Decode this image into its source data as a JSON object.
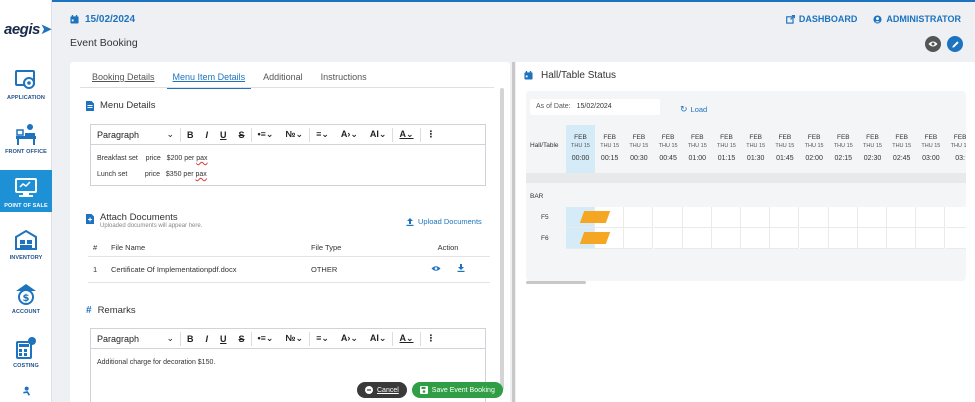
{
  "sidebar": {
    "logo": "aegis",
    "items": [
      {
        "label": "APPLICATION",
        "icon": "application-gear-icon",
        "active": false
      },
      {
        "label": "FRONT OFFICE",
        "icon": "front-office-icon",
        "active": false
      },
      {
        "label": "POINT OF SALE",
        "icon": "point-of-sale-icon",
        "active": true
      },
      {
        "label": "INVENTORY",
        "icon": "inventory-icon",
        "active": false
      },
      {
        "label": "ACCOUNT",
        "icon": "account-dollar-icon",
        "active": false
      },
      {
        "label": "COSTING",
        "icon": "costing-calculator-icon",
        "active": false
      }
    ]
  },
  "header": {
    "date": "15/02/2024",
    "dashboard_label": "DASHBOARD",
    "user_label": "ADMINISTRATOR"
  },
  "page_title": "Event Booking",
  "tabs": [
    {
      "label": "Booking Details",
      "active": false
    },
    {
      "label": "Menu Item Details",
      "active": true
    },
    {
      "label": "Additional",
      "active": false
    },
    {
      "label": "Instructions",
      "active": false
    }
  ],
  "menu_details": {
    "title": "Menu Details",
    "paragraph_label": "Paragraph",
    "lines": [
      {
        "name": "Breakfast set",
        "price_label": "price",
        "amount": "$200 per",
        "unit": "pax"
      },
      {
        "name": "Lunch set",
        "price_label": "price",
        "amount": "$350 per",
        "unit": "pax"
      }
    ]
  },
  "attach_documents": {
    "title": "Attach Documents",
    "subtitle": "Uploaded documents will appear here.",
    "upload_label": "Upload Documents",
    "columns": [
      "#",
      "File Name",
      "File Type",
      "Action"
    ],
    "rows": [
      {
        "num": "1",
        "file_name": "Certificate Of Implementationpdf.docx",
        "file_type": "OTHER"
      }
    ]
  },
  "remarks": {
    "title": "Remarks",
    "paragraph_label": "Paragraph",
    "text": "Additional charge for decoration $150."
  },
  "footer": {
    "cancel_label": "Cancel",
    "save_label": "Save Event Booking"
  },
  "hall_status": {
    "title": "Hall/Table Status",
    "as_of_label": "As of Date:",
    "as_of_value": "15/02/2024",
    "load_label": "Load",
    "corner_label": "Hall/Table",
    "month": "FEB",
    "weekday": "THU 15",
    "times": [
      "00:00",
      "00:15",
      "00:30",
      "00:45",
      "01:00",
      "01:15",
      "01:30",
      "01:45",
      "02:00",
      "02:15",
      "02:30",
      "02:45",
      "03:00",
      "03:"
    ],
    "group_label": "BAR",
    "tables": [
      "F5",
      "F6"
    ]
  },
  "colors": {
    "accent": "#1e73be",
    "active_nav": "#1e90d6",
    "booking": "#f5a623",
    "save": "#2f9e44",
    "cancel": "#3a3a3a"
  }
}
